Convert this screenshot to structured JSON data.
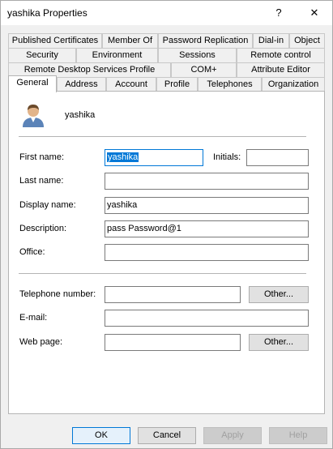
{
  "window": {
    "title": "yashika Properties",
    "help_glyph": "?",
    "close_glyph": "✕"
  },
  "tabs": {
    "row1": [
      "Published Certificates",
      "Member Of",
      "Password Replication",
      "Dial-in",
      "Object"
    ],
    "row2": [
      "Security",
      "Environment",
      "Sessions",
      "Remote control"
    ],
    "row3": [
      "Remote Desktop Services Profile",
      "COM+",
      "Attribute Editor"
    ],
    "row4": [
      "General",
      "Address",
      "Account",
      "Profile",
      "Telephones",
      "Organization"
    ],
    "active": "General"
  },
  "general": {
    "user_icon": "user-icon",
    "user_name": "yashika",
    "first_name_label": "First name:",
    "first_name_value": "yashika",
    "initials_label": "Initials:",
    "initials_value": "",
    "last_name_label": "Last name:",
    "last_name_value": "",
    "display_name_label": "Display name:",
    "display_name_value": "yashika",
    "description_label": "Description:",
    "description_value": "pass Password@1",
    "office_label": "Office:",
    "office_value": "",
    "telephone_label": "Telephone number:",
    "telephone_value": "",
    "telephone_other": "Other...",
    "email_label": "E-mail:",
    "email_value": "",
    "webpage_label": "Web page:",
    "webpage_value": "",
    "webpage_other": "Other..."
  },
  "footer": {
    "ok": "OK",
    "cancel": "Cancel",
    "apply": "Apply",
    "help": "Help"
  }
}
